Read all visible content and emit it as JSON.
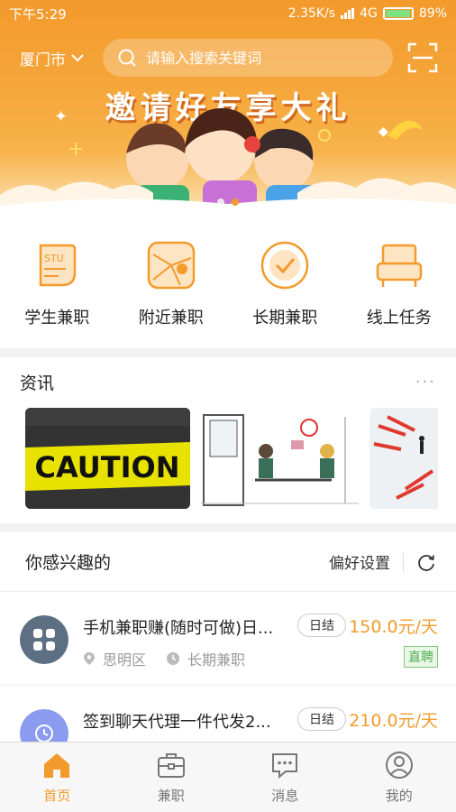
{
  "status_bar": {
    "time": "下午5:29",
    "network_speed": "2.35K/s",
    "network": "4G",
    "battery": "89%",
    "battery_level": 0.89
  },
  "header": {
    "city": "厦门市",
    "search_placeholder": "请输入搜索关键词"
  },
  "banner": {
    "title": "邀请好友享大礼",
    "slide_count": 2,
    "active_slide": 1
  },
  "categories": [
    {
      "label": "学生兼职",
      "icon": "student-card-icon",
      "badge": "STU"
    },
    {
      "label": "附近兼职",
      "icon": "map-pin-icon"
    },
    {
      "label": "长期兼职",
      "icon": "clock-check-icon"
    },
    {
      "label": "线上任务",
      "icon": "sofa-icon"
    }
  ],
  "news": {
    "title": "资讯",
    "more": "···",
    "items": [
      {
        "caption": "CAUTION",
        "image": "caution-tape-image"
      },
      {
        "image": "office-meeting-image"
      },
      {
        "image": "arrows-strategy-image"
      }
    ]
  },
  "interest": {
    "title": "你感兴趣的",
    "preference": "偏好设置",
    "jobs": [
      {
        "title": "手机兼职赚(随时可做)日...",
        "tag": "日结",
        "price": "150.0元/天",
        "district": "思明区",
        "period": "长期兼职",
        "badge": "直聘",
        "avatar_color": "#5d7083"
      },
      {
        "title": "签到聊天代理一件代发2...",
        "tag": "日结",
        "price": "210.0元/天",
        "avatar_color": "#8a9bf0"
      }
    ]
  },
  "tabbar": {
    "tabs": [
      {
        "label": "首页",
        "icon": "home-icon",
        "active": true
      },
      {
        "label": "兼职",
        "icon": "briefcase-icon"
      },
      {
        "label": "消息",
        "icon": "message-icon"
      },
      {
        "label": "我的",
        "icon": "user-icon"
      }
    ]
  },
  "colors": {
    "accent": "#f39a2c",
    "green_badge": "#4caf50"
  }
}
